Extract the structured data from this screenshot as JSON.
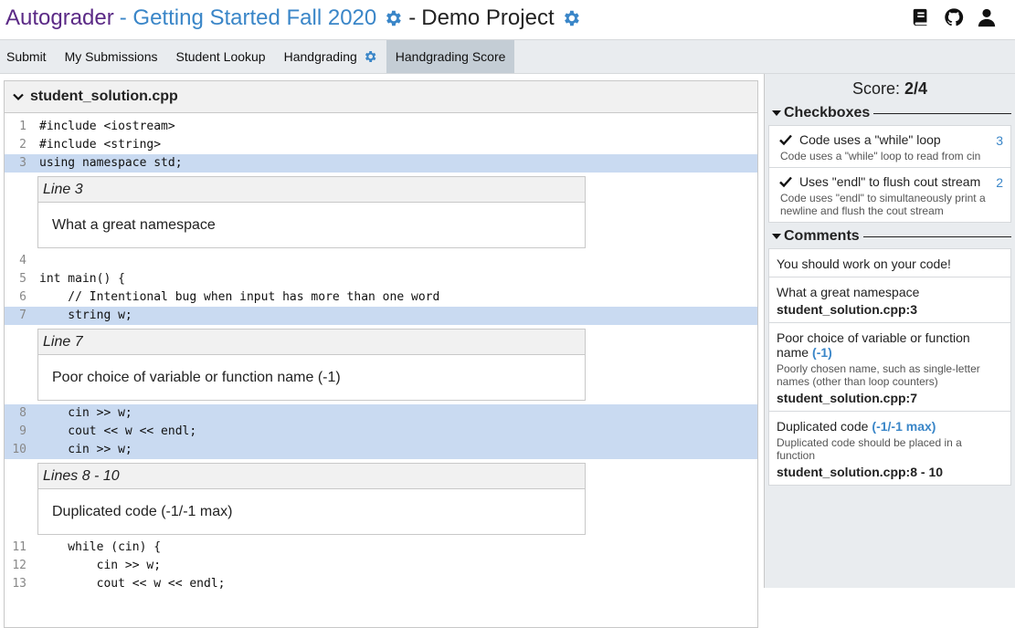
{
  "header": {
    "brand": "Autograder",
    "course": "- Getting Started Fall 2020",
    "separator": "-",
    "project": "Demo Project",
    "icons": [
      "book-icon",
      "github-icon",
      "user-icon"
    ]
  },
  "nav": {
    "tabs": [
      {
        "label": "Submit"
      },
      {
        "label": "My Submissions"
      },
      {
        "label": "Student Lookup"
      },
      {
        "label": "Handgrading"
      },
      {
        "label": "Handgrading Score"
      }
    ],
    "active": "Handgrading Score"
  },
  "file": {
    "name": "student_solution.cpp",
    "lines": [
      {
        "num": "1",
        "text": "#include <iostream>",
        "hl": false
      },
      {
        "num": "2",
        "text": "#include <string>",
        "hl": false
      },
      {
        "num": "3",
        "text": "using namespace std;",
        "hl": true
      },
      {
        "num": "4",
        "text": "",
        "hl": false
      },
      {
        "num": "5",
        "text": "int main() {",
        "hl": false
      },
      {
        "num": "6",
        "text": "    // Intentional bug when input has more than one word",
        "hl": false
      },
      {
        "num": "7",
        "text": "    string w;",
        "hl": true
      },
      {
        "num": "8",
        "text": "    cin >> w;",
        "hl": true
      },
      {
        "num": "9",
        "text": "    cout << w << endl;",
        "hl": true
      },
      {
        "num": "10",
        "text": "    cin >> w;",
        "hl": true
      },
      {
        "num": "11",
        "text": "    while (cin) {",
        "hl": false
      },
      {
        "num": "12",
        "text": "        cin >> w;",
        "hl": false
      },
      {
        "num": "13",
        "text": "        cout << w << endl;",
        "hl": false
      }
    ],
    "inline_comments": [
      {
        "header": "Line 3",
        "text": "What a great namespace"
      },
      {
        "header": "Line 7",
        "text": "Poor choice of variable or function name (-1)"
      },
      {
        "header": "Lines 8 - 10",
        "text": "Duplicated code (-1/-1 max)"
      }
    ]
  },
  "sidebar": {
    "score_label": "Score:",
    "score_value": "2/4",
    "checkboxes_title": "Checkboxes",
    "checkboxes": [
      {
        "label": "Code uses a \"while\" loop",
        "points": "3",
        "desc": "Code uses a \"while\" loop to read from cin",
        "checked": true
      },
      {
        "label": "Uses \"endl\" to flush cout stream",
        "points": "2",
        "desc": "Code uses \"endl\" to simultaneously print a newline and flush the cout stream",
        "checked": true
      }
    ],
    "comments_title": "Comments",
    "comments": [
      {
        "text": "You should work on your code!",
        "points": "",
        "desc": "",
        "location": ""
      },
      {
        "text": "What a great namespace",
        "points": "",
        "desc": "",
        "location": "student_solution.cpp:3"
      },
      {
        "text": "Poor choice of variable or function name",
        "points": "(-1)",
        "desc": "Poorly chosen name, such as single-letter names (other than loop counters)",
        "location": "student_solution.cpp:7"
      },
      {
        "text": "Duplicated code",
        "points": "(-1/-1 max)",
        "desc": "Duplicated code should be placed in a function",
        "location": "student_solution.cpp:8 - 10"
      }
    ]
  },
  "colors": {
    "brand": "#5b2a86",
    "link": "#3a86c8",
    "highlight": "#c9daf1",
    "nav_bg": "#e9ecef",
    "nav_active": "#c4cdd5"
  }
}
